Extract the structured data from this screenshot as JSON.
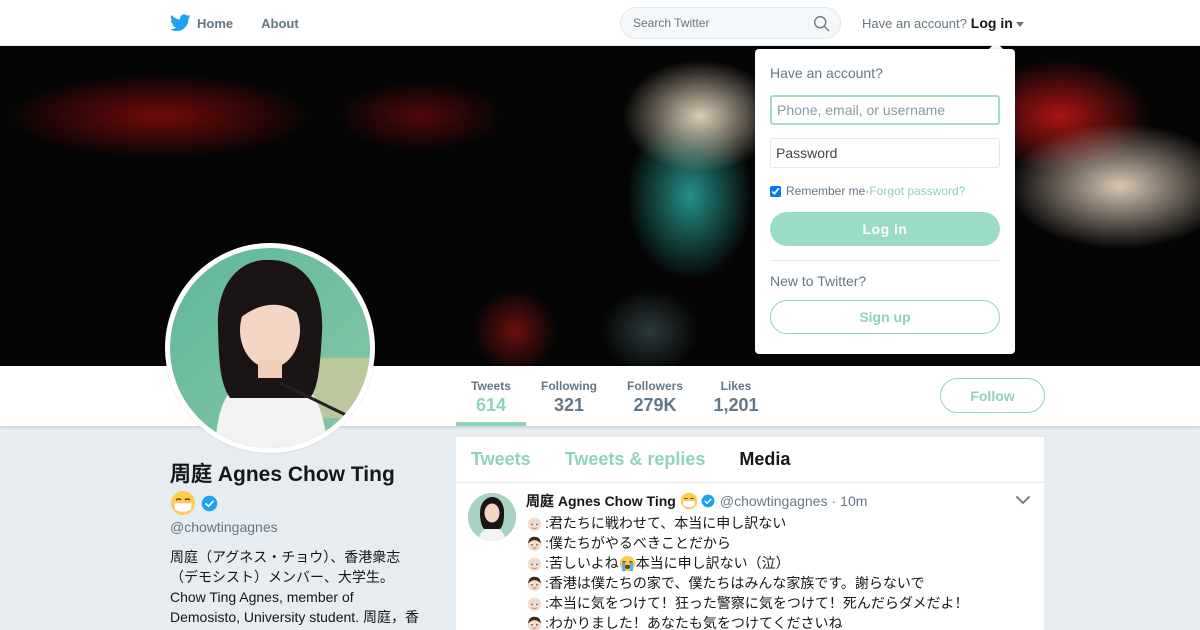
{
  "nav": {
    "home_label": "Home",
    "about_label": "About",
    "search_placeholder": "Search Twitter",
    "have_account_text": "Have an account?",
    "login_label": "Log in"
  },
  "colors": {
    "accent": "#8fd3bc",
    "twitter_blue": "#1da1f2",
    "text_dark": "#14171a",
    "text_gray": "#657786"
  },
  "icons": {
    "logo": "twitter-bird-icon",
    "search": "search-icon",
    "dropdown": "caret-down-icon",
    "verified": "verified-badge-icon",
    "mask": "face-with-medical-mask-emoji",
    "tweet_menu": "chevron-down-icon"
  },
  "profile": {
    "name": "周庭 Agnes Chow Ting",
    "handle": "@chowtingagnes",
    "bio": "周庭（アグネス・チョウ）、香港衆志（デモシスト）メンバー、大学生。 Chow Ting Agnes, member of Demosisto, University student. 周庭，香"
  },
  "stats": [
    {
      "label": "Tweets",
      "value": "614",
      "active": true
    },
    {
      "label": "Following",
      "value": "321",
      "active": false
    },
    {
      "label": "Followers",
      "value": "279K",
      "active": false
    },
    {
      "label": "Likes",
      "value": "1,201",
      "active": false
    }
  ],
  "follow_label": "Follow",
  "timeline": {
    "tabs": [
      {
        "label": "Tweets",
        "active": false
      },
      {
        "label": "Tweets & replies",
        "active": false
      },
      {
        "label": "Media",
        "active": true
      }
    ],
    "tweet": {
      "name": "周庭 Agnes Chow Ting",
      "handle": "@chowtingagnes",
      "separator": "·",
      "time": "10m",
      "lines": [
        {
          "face": "old-man-emoji",
          "text": ":君たちに戦わせて、本当に申し訳ない"
        },
        {
          "face": "young-man-emoji",
          "text": ":僕たちがやるべきことだから"
        },
        {
          "face": "old-man-emoji",
          "text": ":苦しいよね",
          "emoji": "loudly-crying-face-emoji",
          "text2": "本当に申し訳ない（泣）"
        },
        {
          "face": "young-man-emoji",
          "text": ":香港は僕たちの家で、僕たちはみんな家族です。謝らないで"
        },
        {
          "face": "old-man-emoji",
          "text": ":本当に気をつけて！狂った警察に気をつけて！死んだらダメだよ！"
        },
        {
          "face": "young-man-emoji",
          "text": ":わかりました！あなたも気をつけてくださいね"
        }
      ]
    }
  },
  "login_dropdown": {
    "title": "Have an account?",
    "username_placeholder": "Phone, email, or username",
    "password_placeholder": "Password",
    "remember_label": "Remember me",
    "separator": " · ",
    "forgot_label": "Forgot password?",
    "login_button": "Log in",
    "new_text": "New to Twitter?",
    "signup_button": "Sign up"
  }
}
